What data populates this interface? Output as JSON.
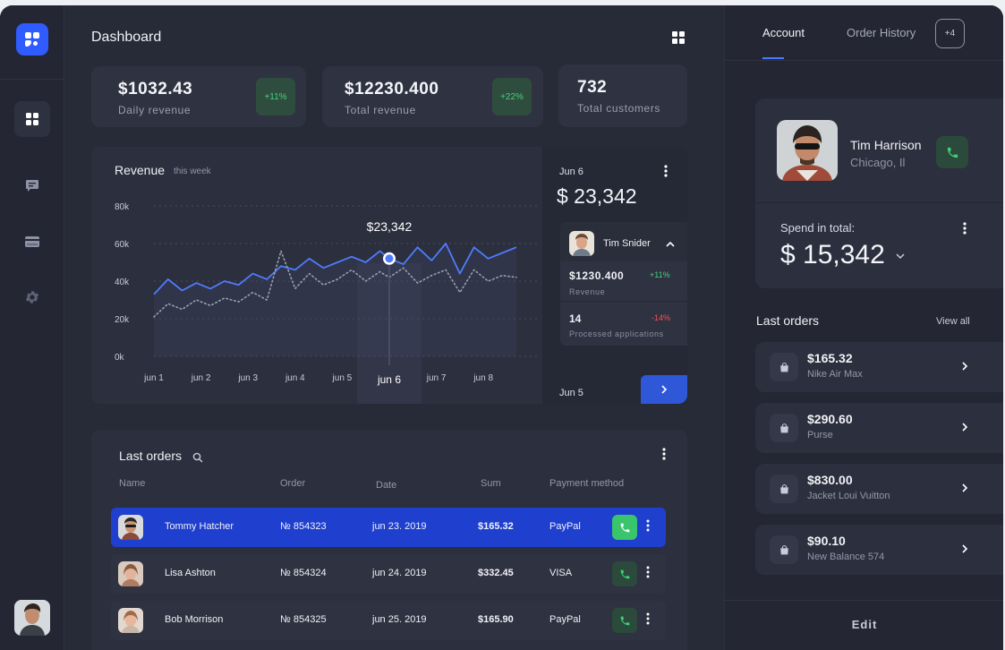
{
  "header": {
    "title": "Dashboard"
  },
  "stats": [
    {
      "value": "$1032.43",
      "label": "Daily revenue",
      "badge": "+11%"
    },
    {
      "value": "$12230.400",
      "label": "Total revenue",
      "badge": "+22%"
    },
    {
      "value": "732",
      "label": "Total customers"
    }
  ],
  "revenue": {
    "title": "Revenue",
    "subtitle": "this week",
    "tooltip_value": "$23,342",
    "highlight_label": "jun 6"
  },
  "chart_data": {
    "type": "line",
    "title": "Revenue",
    "subtitle": "this week",
    "y_ticks": [
      "80k",
      "60k",
      "40k",
      "20k",
      "0k"
    ],
    "ylim": [
      0,
      80000
    ],
    "x_ticks": [
      "jun 1",
      "jun 2",
      "jun 3",
      "jun 4",
      "jun 5",
      "jun 6",
      "jun 7",
      "jun 8"
    ],
    "xlim": [
      1,
      8.7
    ],
    "highlight": {
      "x": 6,
      "label": "$23,342"
    },
    "series": [
      {
        "style": "solid",
        "color": "#4f7bff",
        "x": [
          1,
          1.3,
          1.6,
          1.9,
          2.2,
          2.5,
          2.8,
          3.1,
          3.4,
          3.7,
          4.0,
          4.3,
          4.6,
          4.9,
          5.2,
          5.5,
          5.8,
          6.0,
          6.3,
          6.6,
          6.9,
          7.2,
          7.5,
          7.8,
          8.1,
          8.4,
          8.7
        ],
        "y": [
          33000,
          41000,
          35000,
          39000,
          36000,
          40000,
          38000,
          44000,
          41000,
          48000,
          46000,
          52000,
          47000,
          50000,
          53000,
          50000,
          56000,
          52000,
          49000,
          58000,
          51000,
          60000,
          44000,
          58000,
          52000,
          55000,
          58000
        ]
      },
      {
        "style": "dotted",
        "color": "#9aa0b2",
        "x": [
          1,
          1.3,
          1.6,
          1.9,
          2.2,
          2.5,
          2.8,
          3.1,
          3.4,
          3.7,
          4.0,
          4.3,
          4.6,
          4.9,
          5.2,
          5.5,
          5.8,
          6.0,
          6.3,
          6.6,
          6.9,
          7.2,
          7.5,
          7.8,
          8.1,
          8.4,
          8.7
        ],
        "y": [
          21000,
          28000,
          25000,
          30000,
          27000,
          31000,
          29000,
          34000,
          30000,
          56000,
          36000,
          44000,
          38000,
          41000,
          46000,
          40000,
          45000,
          42000,
          47000,
          39000,
          43000,
          46000,
          34000,
          46000,
          40000,
          43000,
          42000
        ]
      }
    ]
  },
  "side": {
    "date": "Jun 6",
    "amount": "$ 23,342",
    "person": "Tim Snider",
    "value1": "$1230.400",
    "pct1": "+11%",
    "label1": "Revenue",
    "value2": "14",
    "pct2": "-14%",
    "label2": "Processed applications",
    "date2": "Jun 5"
  },
  "orders": {
    "title": "Last orders",
    "columns": [
      "Name",
      "Order",
      "Date",
      "Sum",
      "Payment method"
    ],
    "rows": [
      {
        "name": "Tommy Hatcher",
        "order": "№ 854323",
        "date": "jun 23. 2019",
        "sum": "$165.32",
        "method": "PayPal"
      },
      {
        "name": "Lisa Ashton",
        "order": "№ 854324",
        "date": "jun 24. 2019",
        "sum": "$332.45",
        "method": "VISA"
      },
      {
        "name": "Bob Morrison",
        "order": "№ 854325",
        "date": "jun 25. 2019",
        "sum": "$165.90",
        "method": "PayPal"
      }
    ]
  },
  "right": {
    "tabs": [
      "Account",
      "Order History"
    ],
    "more": "+4",
    "customer": {
      "name": "Tim Harrison",
      "location": "Chicago, Il"
    },
    "spend_label": "Spend in total:",
    "spend_value": "$ 15,342",
    "last_orders_title": "Last orders",
    "view_all": "View all",
    "items": [
      {
        "price": "$165.32",
        "name": "Nike Air Max"
      },
      {
        "price": "$290.60",
        "name": "Purse"
      },
      {
        "price": "$830.00",
        "name": "Jacket Loui Vuitton"
      },
      {
        "price": "$90.10",
        "name": "New Balance 574"
      }
    ],
    "edit": "Edit"
  },
  "colors": {
    "accent": "#2f5bff",
    "positive": "#44d17a",
    "negative": "#ff4d4d",
    "bg": "#242633"
  }
}
